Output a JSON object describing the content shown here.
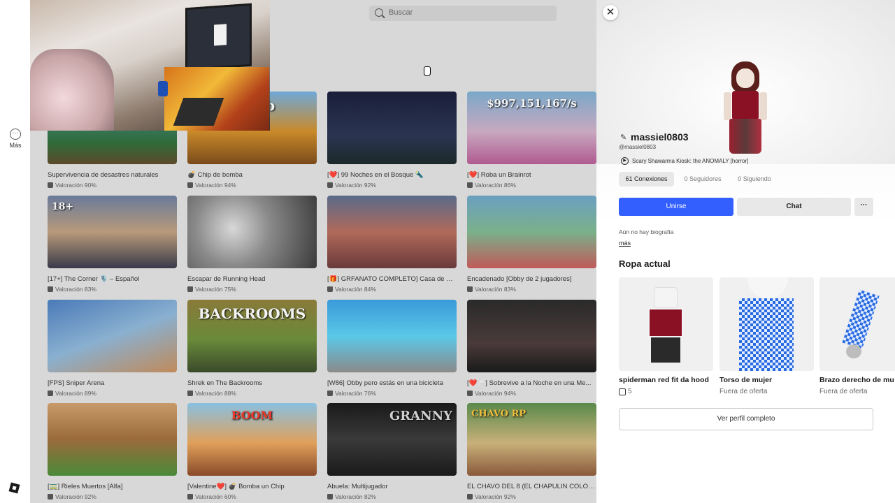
{
  "rail": {
    "more_label": "Más"
  },
  "search": {
    "placeholder": "Buscar"
  },
  "colors": {
    "accent": "#335fff",
    "dim_overlay": "#d8d8d8"
  },
  "games": [
    {
      "title": "Supervivencia de desastres naturales",
      "rating": "Valoración 90%"
    },
    {
      "title": "💣 Chip de bomba",
      "rating": "Valoración 94%",
      "thumb_text": "Bomb"
    },
    {
      "title": "[❤️] 99 Noches en el Bosque 🔦",
      "rating": "Valoración 92%"
    },
    {
      "title": "[❤️] Roba un Brainrot",
      "rating": "Valoración 86%",
      "thumb_text": "$997,151,167/s"
    },
    {
      "title": "[17+] The Corner 🎙️ – Español",
      "rating": "Valoración 83%",
      "thumb_text": "18+"
    },
    {
      "title": "Escapar de Running Head",
      "rating": "Valoración 75%"
    },
    {
      "title": "[🎁] GRFANATO COMPLETO] Casa de Fe...",
      "rating": "Valoración 84%"
    },
    {
      "title": "Encadenado [Obby de 2 jugadores]",
      "rating": "Valoración 83%"
    },
    {
      "title": "[FPS] Sniper Arena",
      "rating": "Valoración 89%"
    },
    {
      "title": "Shrek en The Backrooms",
      "rating": "Valoración 88%",
      "thumb_text": "BACKROOMS"
    },
    {
      "title": "[W86] Obby pero estás en una bicicleta",
      "rating": "Valoración 76%"
    },
    {
      "title": "[❤️🩹] Sobrevive a la Noche en una Me...",
      "rating": "Valoración 94%"
    },
    {
      "title": "[🚃] Rieles Muertos [Alfa]",
      "rating": "Valoración 92%"
    },
    {
      "title": "[Valentine❤️] 💣 Bomba un Chip",
      "rating": "Valoración 60%",
      "thumb_text": "BOOM"
    },
    {
      "title": "Abuela: Multijugador",
      "rating": "Valoración 82%",
      "thumb_text": "GRANNY"
    },
    {
      "title": "EL CHAVO DEL 8 (EL CHAPULIN COLOR...",
      "rating": "Valoración 92%",
      "thumb_text": "CHAVO RP"
    }
  ],
  "profile": {
    "username": "massiel0803",
    "handle": "@massiel0803",
    "playing": "Scary Shawarma Kiosk: the ANOMALY [horror]",
    "connections": "61 Conexiones",
    "followers": "0 Seguidores",
    "following": "0 Siguiendo",
    "join_label": "Unirse",
    "chat_label": "Chat",
    "more_label": "···",
    "bio": "Aún no hay biografía",
    "more_link": "más",
    "outfit_title": "Ropa actual",
    "outfit": [
      {
        "name": "spiderman red fit da hood",
        "price": "5",
        "robux": true
      },
      {
        "name": "Torso de mujer",
        "price": "Fuera de oferta",
        "robux": false
      },
      {
        "name": "Brazo derecho de mu",
        "price": "Fuera de oferta",
        "robux": false
      }
    ],
    "full_profile_label": "Ver perfil completo",
    "close_label": "✕"
  }
}
